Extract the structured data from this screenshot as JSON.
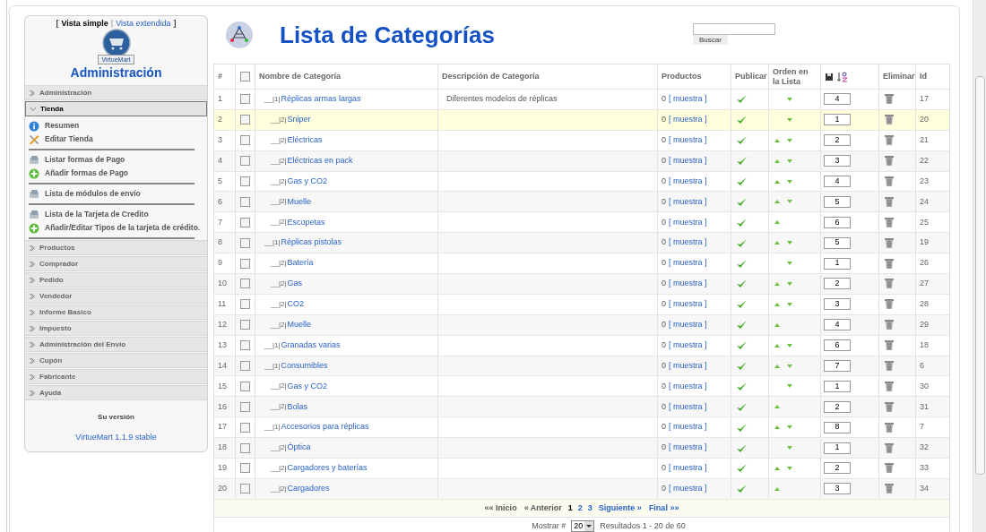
{
  "sidebar": {
    "view_links": {
      "open": "[",
      "simple": "Vista simple",
      "separator": "|",
      "extended": "Vista extendida",
      "close": "]"
    },
    "logo_text": "VirtueMart",
    "title": "Administración",
    "sections": [
      {
        "label": "Administración",
        "expanded": false
      },
      {
        "label": "Tienda",
        "expanded": true,
        "groups": [
          [
            {
              "label": "Resumen",
              "kind": "info"
            },
            {
              "label": "Editar Tienda",
              "kind": "tools"
            }
          ],
          [
            {
              "label": "Listar formas de Pago",
              "kind": "card"
            },
            {
              "label": "Añadir formas de Pago",
              "kind": "add"
            }
          ],
          [
            {
              "label": "Lista de módulos de envío",
              "kind": "card"
            }
          ],
          [
            {
              "label": "Lista de la Tarjeta de Credito",
              "kind": "card"
            },
            {
              "label": "Añadir/Editar Tipos de la tarjeta de crédito.",
              "kind": "add"
            }
          ]
        ]
      },
      {
        "label": "Productos",
        "expanded": false
      },
      {
        "label": "Comprador",
        "expanded": false
      },
      {
        "label": "Pedido",
        "expanded": false
      },
      {
        "label": "Vendedor",
        "expanded": false
      },
      {
        "label": "Informe Basico",
        "expanded": false
      },
      {
        "label": "Impuesto",
        "expanded": false
      },
      {
        "label": "Administración del Envío",
        "expanded": false
      },
      {
        "label": "Cupón",
        "expanded": false
      },
      {
        "label": "Fabricante",
        "expanded": false
      },
      {
        "label": "Ayuda",
        "expanded": false
      }
    ],
    "version_label": "Su versión",
    "version": "VirtueMart 1.1.9 stable"
  },
  "page_title": "Lista de Categorías",
  "search": {
    "button": "Buscar"
  },
  "table": {
    "columns": {
      "number": "#",
      "name": "Nombre de Categoría",
      "description": "Descripción de Categoría",
      "products": "Productos",
      "publish": "Publicar",
      "order": "Orden en la Lista",
      "delete": "Eliminar",
      "id": "Id"
    },
    "select_all_checked": false,
    "rows": [
      {
        "number": "1",
        "marker": "__|1|",
        "name": "Réplicas armas largas",
        "description": "Diferentes modelos de réplicas",
        "products": "0",
        "link": "[ muestra ]",
        "published": true,
        "up": false,
        "down": true,
        "order": "4",
        "id": "17",
        "highlighted": false,
        "checked": false,
        "children": [
          {
            "number": "2",
            "marker": "__|2|",
            "name": "Sniper",
            "products": "0",
            "link": "[ muestra ]",
            "published": true,
            "up": false,
            "down": true,
            "order": "1",
            "id": "20",
            "highlighted": true,
            "checked": false
          },
          {
            "number": "3",
            "marker": "__|2|",
            "name": "Eléctricas",
            "products": "0",
            "link": "[ muestra ]",
            "published": true,
            "up": true,
            "down": true,
            "order": "2",
            "id": "21",
            "highlighted": false,
            "checked": false
          },
          {
            "number": "4",
            "marker": "__|2|",
            "name": "Eléctricas en pack",
            "products": "0",
            "link": "[ muestra ]",
            "published": true,
            "up": true,
            "down": true,
            "order": "3",
            "id": "22",
            "highlighted": false,
            "checked": false
          },
          {
            "number": "5",
            "marker": "__|2|",
            "name": "Gas y CO2",
            "products": "0",
            "link": "[ muestra ]",
            "published": true,
            "up": true,
            "down": true,
            "order": "4",
            "id": "23",
            "highlighted": false,
            "checked": false
          },
          {
            "number": "6",
            "marker": "__|2|",
            "name": "Muelle",
            "products": "0",
            "link": "[ muestra ]",
            "published": true,
            "up": true,
            "down": true,
            "order": "5",
            "id": "24",
            "highlighted": false,
            "checked": false
          },
          {
            "number": "7",
            "marker": "__|2|",
            "name": "Escopetas",
            "products": "0",
            "link": "[ muestra ]",
            "published": true,
            "up": true,
            "down": false,
            "order": "6",
            "id": "25",
            "highlighted": false,
            "checked": false
          }
        ]
      },
      {
        "number": "8",
        "marker": "__|1|",
        "name": "Réplicas pistolas",
        "products": "0",
        "link": "[ muestra ]",
        "published": true,
        "up": true,
        "down": true,
        "order": "5",
        "id": "19",
        "highlighted": false,
        "checked": false,
        "children": [
          {
            "number": "9",
            "marker": "__|2|",
            "name": "Batería",
            "products": "0",
            "link": "[ muestra ]",
            "published": true,
            "up": false,
            "down": true,
            "order": "1",
            "id": "26",
            "highlighted": false,
            "checked": false
          },
          {
            "number": "10",
            "marker": "__|2|",
            "name": "Gas",
            "products": "0",
            "link": "[ muestra ]",
            "published": true,
            "up": true,
            "down": true,
            "order": "2",
            "id": "27",
            "highlighted": false,
            "checked": false
          },
          {
            "number": "11",
            "marker": "__|2|",
            "name": "CO2",
            "products": "0",
            "link": "[ muestra ]",
            "published": true,
            "up": true,
            "down": true,
            "order": "3",
            "id": "28",
            "highlighted": false,
            "checked": false
          },
          {
            "number": "12",
            "marker": "__|2|",
            "name": "Muelle",
            "products": "0",
            "link": "[ muestra ]",
            "published": true,
            "up": true,
            "down": false,
            "order": "4",
            "id": "29",
            "highlighted": false,
            "checked": false
          }
        ]
      },
      {
        "number": "13",
        "marker": "__|1|",
        "name": "Granadas varias",
        "products": "0",
        "link": "[ muestra ]",
        "published": true,
        "up": true,
        "down": true,
        "order": "6",
        "id": "18",
        "highlighted": false,
        "checked": false
      },
      {
        "number": "14",
        "marker": "__|1|",
        "name": "Consumibles",
        "products": "0",
        "link": "[ muestra ]",
        "published": true,
        "up": true,
        "down": true,
        "order": "7",
        "id": "6",
        "highlighted": false,
        "checked": false,
        "children": [
          {
            "number": "15",
            "marker": "__|2|",
            "name": "Gas y CO2",
            "products": "0",
            "link": "[ muestra ]",
            "published": true,
            "up": false,
            "down": true,
            "order": "1",
            "id": "30",
            "highlighted": false,
            "checked": false
          },
          {
            "number": "16",
            "marker": "__|2|",
            "name": "Bolas",
            "products": "0",
            "link": "[ muestra ]",
            "published": true,
            "up": true,
            "down": false,
            "order": "2",
            "id": "31",
            "highlighted": false,
            "checked": false
          }
        ]
      },
      {
        "number": "17",
        "marker": "__|1|",
        "name": "Accesorios para réplicas",
        "products": "0",
        "link": "[ muestra ]",
        "published": true,
        "up": true,
        "down": true,
        "order": "8",
        "id": "7",
        "highlighted": false,
        "checked": false,
        "children": [
          {
            "number": "18",
            "marker": "__|2|",
            "name": "Óptica",
            "products": "0",
            "link": "[ muestra ]",
            "published": true,
            "up": false,
            "down": true,
            "order": "1",
            "id": "32",
            "highlighted": false,
            "checked": false
          },
          {
            "number": "19",
            "marker": "__|2|",
            "name": "Cargadores y baterías",
            "products": "0",
            "link": "[ muestra ]",
            "published": true,
            "up": true,
            "down": true,
            "order": "2",
            "id": "33",
            "highlighted": false,
            "checked": false
          },
          {
            "number": "20",
            "marker": "__|2|",
            "name": "Cargadores",
            "products": "0",
            "link": "[ muestra ]",
            "published": true,
            "up": true,
            "down": false,
            "order": "3",
            "id": "34",
            "highlighted": false,
            "checked": false
          }
        ]
      }
    ]
  },
  "pagination": [
    {
      "label": "«« Inicio",
      "selected": false,
      "kind": "nav"
    },
    {
      "label": "« Anterior",
      "selected": false,
      "kind": "nav"
    },
    {
      "label": "1",
      "selected": true,
      "kind": "page"
    },
    {
      "label": "2",
      "selected": false,
      "kind": "page"
    },
    {
      "label": "3",
      "selected": false,
      "kind": "page"
    },
    {
      "label": "Siguiente »",
      "selected": false,
      "kind": "link"
    },
    {
      "label": "Final »»",
      "selected": false,
      "kind": "link"
    }
  ],
  "footer": {
    "show_label": "Mostrar #",
    "page_size": "20",
    "results": "Resultados 1 - 20 de 60"
  }
}
